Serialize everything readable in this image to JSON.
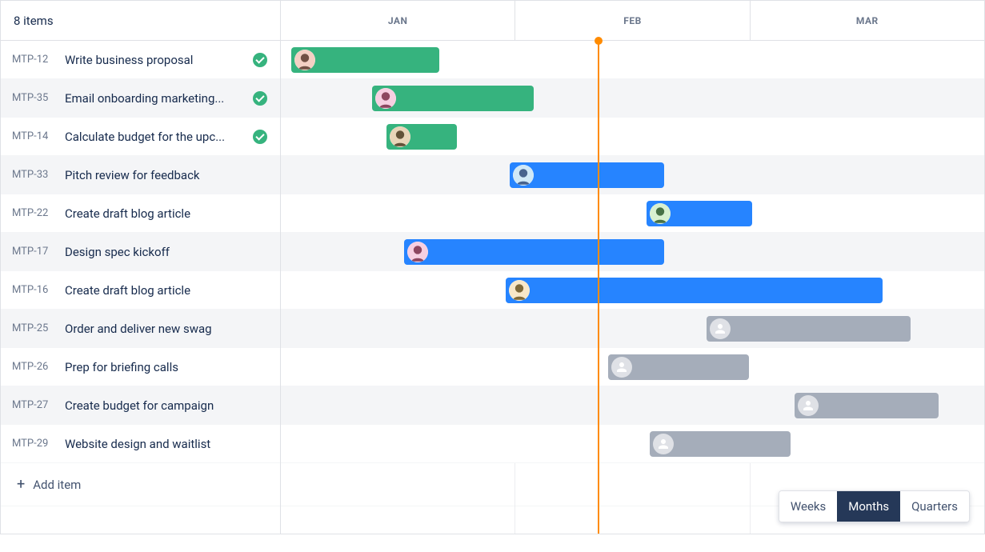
{
  "header": {
    "items_label": "8 items"
  },
  "months": [
    "JAN",
    "FEB",
    "MAR"
  ],
  "today_pct": 45,
  "zoom": {
    "options": [
      "Weeks",
      "Months",
      "Quarters"
    ],
    "active": "Months"
  },
  "add_item_label": "Add item",
  "tasks": [
    {
      "key": "MTP-12",
      "title": "Write business proposal",
      "done": true,
      "bar": {
        "color": "green",
        "start_pct": 1.5,
        "width_pct": 21
      },
      "assignee": {
        "type": "avatar1"
      }
    },
    {
      "key": "MTP-35",
      "title": "Email onboarding marketing...",
      "done": true,
      "bar": {
        "color": "green",
        "start_pct": 13,
        "width_pct": 23
      },
      "assignee": {
        "type": "avatar2"
      }
    },
    {
      "key": "MTP-14",
      "title": "Calculate budget for the upc...",
      "done": true,
      "bar": {
        "color": "green",
        "start_pct": 15,
        "width_pct": 10
      },
      "assignee": {
        "type": "avatar3"
      }
    },
    {
      "key": "MTP-33",
      "title": "Pitch review for feedback",
      "done": false,
      "bar": {
        "color": "blue",
        "start_pct": 32.5,
        "width_pct": 22
      },
      "assignee": {
        "type": "avatar4"
      }
    },
    {
      "key": "MTP-22",
      "title": "Create draft blog article",
      "done": false,
      "bar": {
        "color": "blue",
        "start_pct": 52,
        "width_pct": 15
      },
      "assignee": {
        "type": "avatar5"
      }
    },
    {
      "key": "MTP-17",
      "title": "Design spec kickoff",
      "done": false,
      "bar": {
        "color": "blue",
        "start_pct": 17.5,
        "width_pct": 37
      },
      "assignee": {
        "type": "avatar2"
      }
    },
    {
      "key": "MTP-16",
      "title": "Create draft blog article",
      "done": false,
      "bar": {
        "color": "blue",
        "start_pct": 32,
        "width_pct": 53.5
      },
      "assignee": {
        "type": "avatar6"
      }
    },
    {
      "key": "MTP-25",
      "title": "Order and deliver new swag",
      "done": false,
      "bar": {
        "color": "grey",
        "start_pct": 60.5,
        "width_pct": 29
      },
      "assignee": {
        "type": "unassigned"
      }
    },
    {
      "key": "MTP-26",
      "title": "Prep for briefing calls",
      "done": false,
      "bar": {
        "color": "grey",
        "start_pct": 46.5,
        "width_pct": 20
      },
      "assignee": {
        "type": "unassigned"
      }
    },
    {
      "key": "MTP-27",
      "title": "Create budget for campaign",
      "done": false,
      "bar": {
        "color": "grey",
        "start_pct": 73,
        "width_pct": 20.5
      },
      "assignee": {
        "type": "unassigned"
      }
    },
    {
      "key": "MTP-29",
      "title": "Website design and waitlist",
      "done": false,
      "bar": {
        "color": "grey",
        "start_pct": 52.5,
        "width_pct": 20
      },
      "assignee": {
        "type": "unassigned"
      }
    }
  ]
}
